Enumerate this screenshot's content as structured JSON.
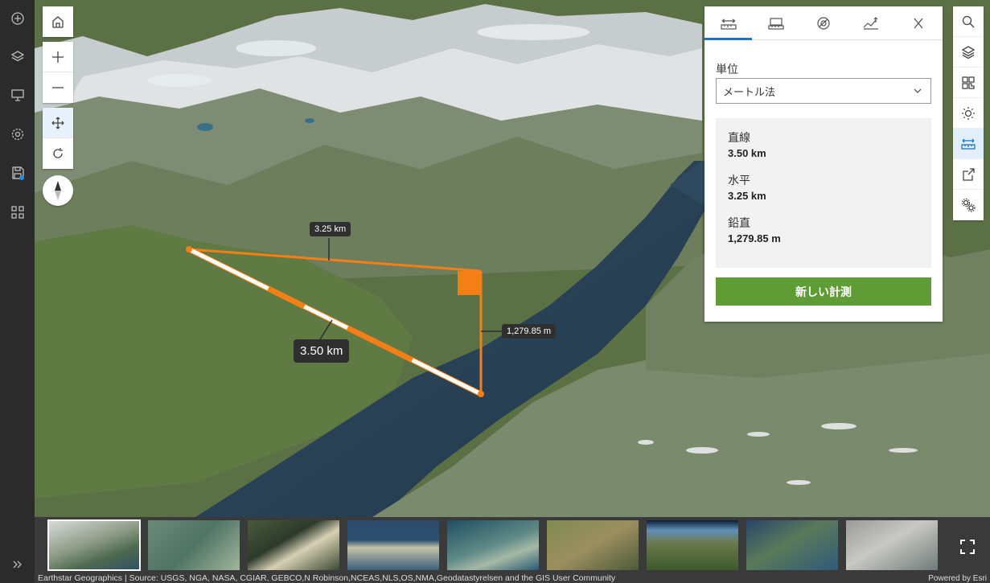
{
  "sidebar": {
    "icons": [
      "add-icon",
      "layers-icon",
      "presentation-icon",
      "settings-icon",
      "save-icon",
      "apps-icon"
    ],
    "expand_icon": "double-chevron-right-icon"
  },
  "navigation": {
    "buttons": [
      "home-icon",
      "zoom-in-icon",
      "zoom-out-icon",
      "pan-icon",
      "rotate-icon"
    ],
    "compass": "compass-icon"
  },
  "measurement_labels": {
    "horizontal": "3.25 km",
    "direct": "3.50 km",
    "vertical": "1,279.85 m"
  },
  "panel": {
    "tabs": [
      "distance-measure-icon",
      "area-measure-icon",
      "slice-icon",
      "elevation-profile-icon"
    ],
    "close_icon": "close-icon",
    "units_label": "単位",
    "units_value": "メートル法",
    "results": [
      {
        "label": "直線",
        "value": "3.50 km"
      },
      {
        "label": "水平",
        "value": "3.25 km"
      },
      {
        "label": "鉛直",
        "value": "1,279.85 m"
      }
    ],
    "new_measurement_button": "新しい計測"
  },
  "right_toolbar": {
    "icons": [
      "search-icon",
      "layers-icon",
      "basemap-icon",
      "daylight-icon",
      "measure-icon",
      "share-icon",
      "tools-icon"
    ],
    "active": "measure-icon"
  },
  "gallery": {
    "thumbnails": [
      "basemap-1",
      "basemap-2",
      "basemap-3",
      "basemap-4",
      "basemap-5",
      "basemap-6",
      "basemap-7",
      "basemap-8",
      "basemap-9"
    ],
    "selected_index": 0,
    "attribution": "Earthstar Geographics | Source: USGS, NGA, NASA, CGIAR, GEBCO,N Robinson,NCEAS,NLS,OS,NMA,Geodatastyrelsen and the GIS User Community",
    "powered_by": "Powered by Esri"
  },
  "colors": {
    "accent": "#1a73c8",
    "measure_line": "#f57f17",
    "button_green": "#5f9c36",
    "sidebar_bg": "#2b2b2b"
  }
}
